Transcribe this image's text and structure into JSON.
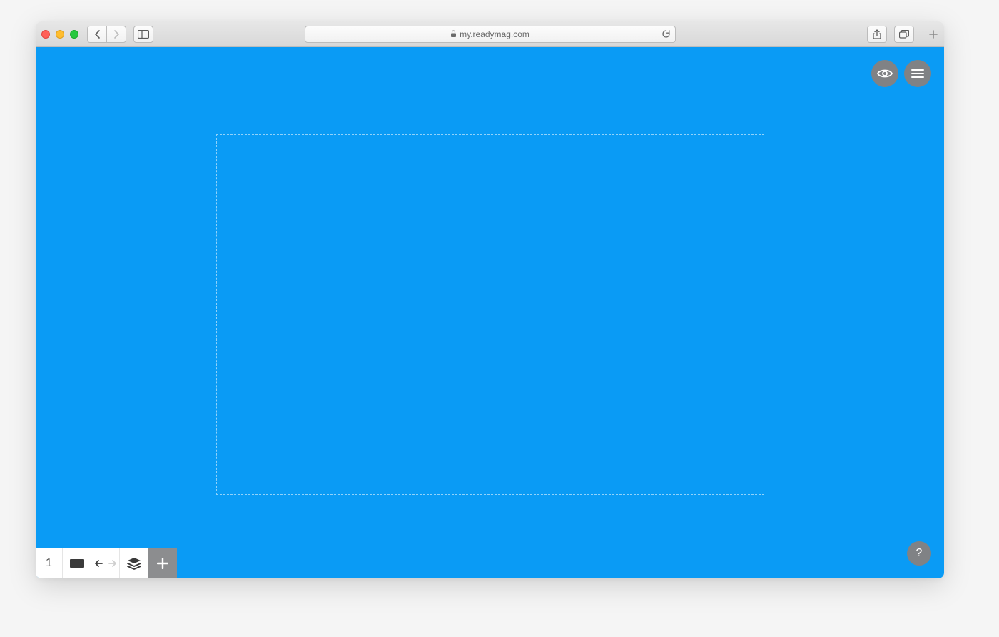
{
  "browser": {
    "url": "my.readymag.com",
    "has_lock": true
  },
  "editor": {
    "page_number": "1",
    "canvas_bg": "#0a9bf5",
    "help_label": "?"
  }
}
